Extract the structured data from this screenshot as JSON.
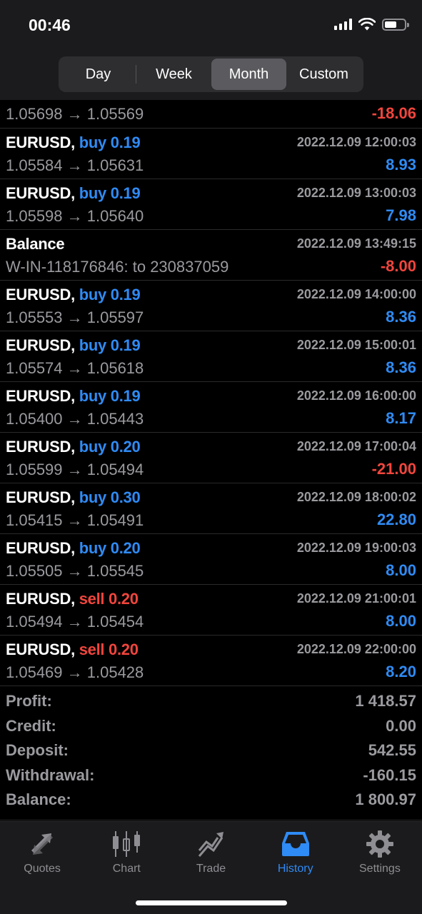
{
  "status_bar": {
    "time": "00:46"
  },
  "period_tabs": [
    {
      "label": "Day",
      "active": false
    },
    {
      "label": "Week",
      "active": false
    },
    {
      "label": "Month",
      "active": true
    },
    {
      "label": "Custom",
      "active": false
    }
  ],
  "partial_row": {
    "prices": "1.05698 → 1.05569",
    "profit": "-18.06"
  },
  "rows": [
    {
      "symbol": "EURUSD,",
      "action": "buy 0.19",
      "side": "buy",
      "time": "2022.12.09 12:00:03",
      "prices": "1.05584 → 1.05631",
      "profit": "8.93",
      "sign": "pos"
    },
    {
      "symbol": "EURUSD,",
      "action": "buy 0.19",
      "side": "buy",
      "time": "2022.12.09 13:00:03",
      "prices": "1.05598 → 1.05640",
      "profit": "7.98",
      "sign": "pos"
    },
    {
      "symbol": "Balance",
      "action": "",
      "side": "none",
      "time": "2022.12.09 13:49:15",
      "prices": "W-IN-118176846: to 230837059",
      "profit": "-8.00",
      "sign": "neg"
    },
    {
      "symbol": "EURUSD,",
      "action": "buy 0.19",
      "side": "buy",
      "time": "2022.12.09 14:00:00",
      "prices": "1.05553 → 1.05597",
      "profit": "8.36",
      "sign": "pos"
    },
    {
      "symbol": "EURUSD,",
      "action": "buy 0.19",
      "side": "buy",
      "time": "2022.12.09 15:00:01",
      "prices": "1.05574 → 1.05618",
      "profit": "8.36",
      "sign": "pos"
    },
    {
      "symbol": "EURUSD,",
      "action": "buy 0.19",
      "side": "buy",
      "time": "2022.12.09 16:00:00",
      "prices": "1.05400 → 1.05443",
      "profit": "8.17",
      "sign": "pos"
    },
    {
      "symbol": "EURUSD,",
      "action": "buy 0.20",
      "side": "buy",
      "time": "2022.12.09 17:00:04",
      "prices": "1.05599 → 1.05494",
      "profit": "-21.00",
      "sign": "neg"
    },
    {
      "symbol": "EURUSD,",
      "action": "buy 0.30",
      "side": "buy",
      "time": "2022.12.09 18:00:02",
      "prices": "1.05415 → 1.05491",
      "profit": "22.80",
      "sign": "pos"
    },
    {
      "symbol": "EURUSD,",
      "action": "buy 0.20",
      "side": "buy",
      "time": "2022.12.09 19:00:03",
      "prices": "1.05505 → 1.05545",
      "profit": "8.00",
      "sign": "pos"
    },
    {
      "symbol": "EURUSD,",
      "action": "sell 0.20",
      "side": "sell",
      "time": "2022.12.09 21:00:01",
      "prices": "1.05494 → 1.05454",
      "profit": "8.00",
      "sign": "pos"
    },
    {
      "symbol": "EURUSD,",
      "action": "sell 0.20",
      "side": "sell",
      "time": "2022.12.09 22:00:00",
      "prices": "1.05469 → 1.05428",
      "profit": "8.20",
      "sign": "pos"
    }
  ],
  "summary": [
    {
      "label": "Profit:",
      "value": "1 418.57"
    },
    {
      "label": "Credit:",
      "value": "0.00"
    },
    {
      "label": "Deposit:",
      "value": "542.55"
    },
    {
      "label": "Withdrawal:",
      "value": "-160.15"
    },
    {
      "label": "Balance:",
      "value": "1 800.97"
    }
  ],
  "tab_bar": [
    {
      "label": "Quotes",
      "icon": "quotes-icon",
      "active": false
    },
    {
      "label": "Chart",
      "icon": "chart-icon",
      "active": false
    },
    {
      "label": "Trade",
      "icon": "trade-icon",
      "active": false
    },
    {
      "label": "History",
      "icon": "history-icon",
      "active": true
    },
    {
      "label": "Settings",
      "icon": "settings-icon",
      "active": false
    }
  ],
  "colors": {
    "buy": "#2f8bf5",
    "sell": "#f2453d",
    "active_tab": "#2f8bf5",
    "inactive": "#8e8e93"
  }
}
